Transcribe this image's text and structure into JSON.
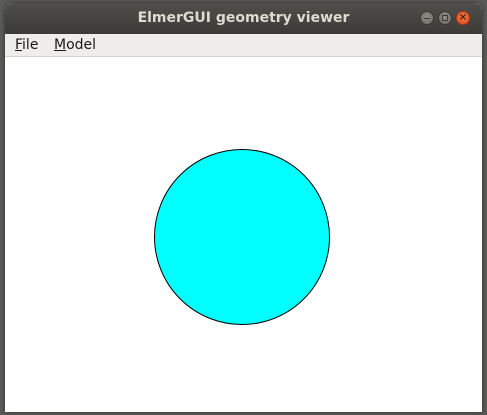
{
  "window": {
    "title": "ElmerGUI geometry viewer"
  },
  "menubar": {
    "items": [
      {
        "mnemonic": "F",
        "rest": "ile"
      },
      {
        "mnemonic": "M",
        "rest": "odel"
      }
    ]
  },
  "viewer": {
    "shape": "circle",
    "fill_color": "#00ffff",
    "outline_color": "#000000",
    "background": "#ffffff"
  },
  "colors": {
    "titlebar": "#3c3b37",
    "close_button": "#e95420"
  }
}
